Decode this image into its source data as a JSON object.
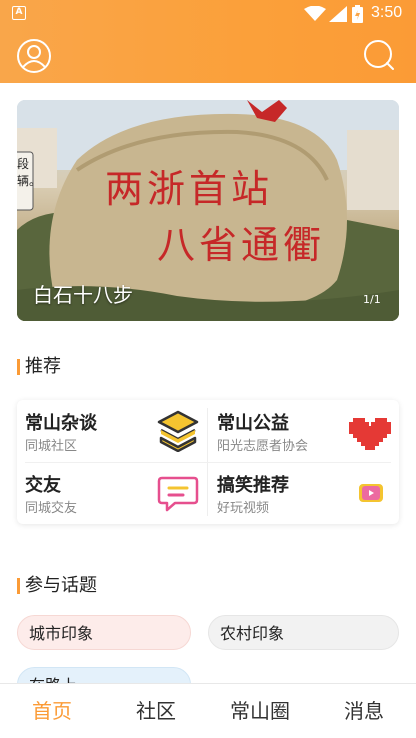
{
  "status_bar": {
    "time": "3:50",
    "app_icon_letter": "A"
  },
  "header": {
    "user_icon": "user-circle-icon",
    "search_icon": "search-icon",
    "gradient_from": "#f9a64a",
    "gradient_to": "#fb9b36"
  },
  "banner": {
    "carved_text_line1": "两浙首站",
    "carved_text_line2": "八省通衢",
    "sign_text": "段辆。",
    "caption": "白石十八步",
    "index": "1/1"
  },
  "recommend": {
    "title": "推荐",
    "items": [
      {
        "title": "常山杂谈",
        "subtitle": "同城社区",
        "icon": "stacked-layers-icon"
      },
      {
        "title": "常山公益",
        "subtitle": "阳光志愿者协会",
        "icon": "pixel-heart-icon"
      },
      {
        "title": "交友",
        "subtitle": "同城交友",
        "icon": "chat-bubble-icon"
      },
      {
        "title": "搞笑推荐",
        "subtitle": "好玩视频",
        "icon": "video-icon"
      }
    ]
  },
  "topics": {
    "title": "参与话题",
    "tags": [
      {
        "label": "城市印象",
        "bg": "#fdecea"
      },
      {
        "label": "农村印象",
        "bg": "#f2f2f2"
      },
      {
        "label": "在路上",
        "bg": "#e4f1fb"
      }
    ]
  },
  "tabbar": {
    "tabs": [
      {
        "label": "首页",
        "active": true
      },
      {
        "label": "社区",
        "active": false
      },
      {
        "label": "常山圈",
        "active": false
      },
      {
        "label": "消息",
        "active": false
      }
    ],
    "accent": "#fb9b36"
  }
}
